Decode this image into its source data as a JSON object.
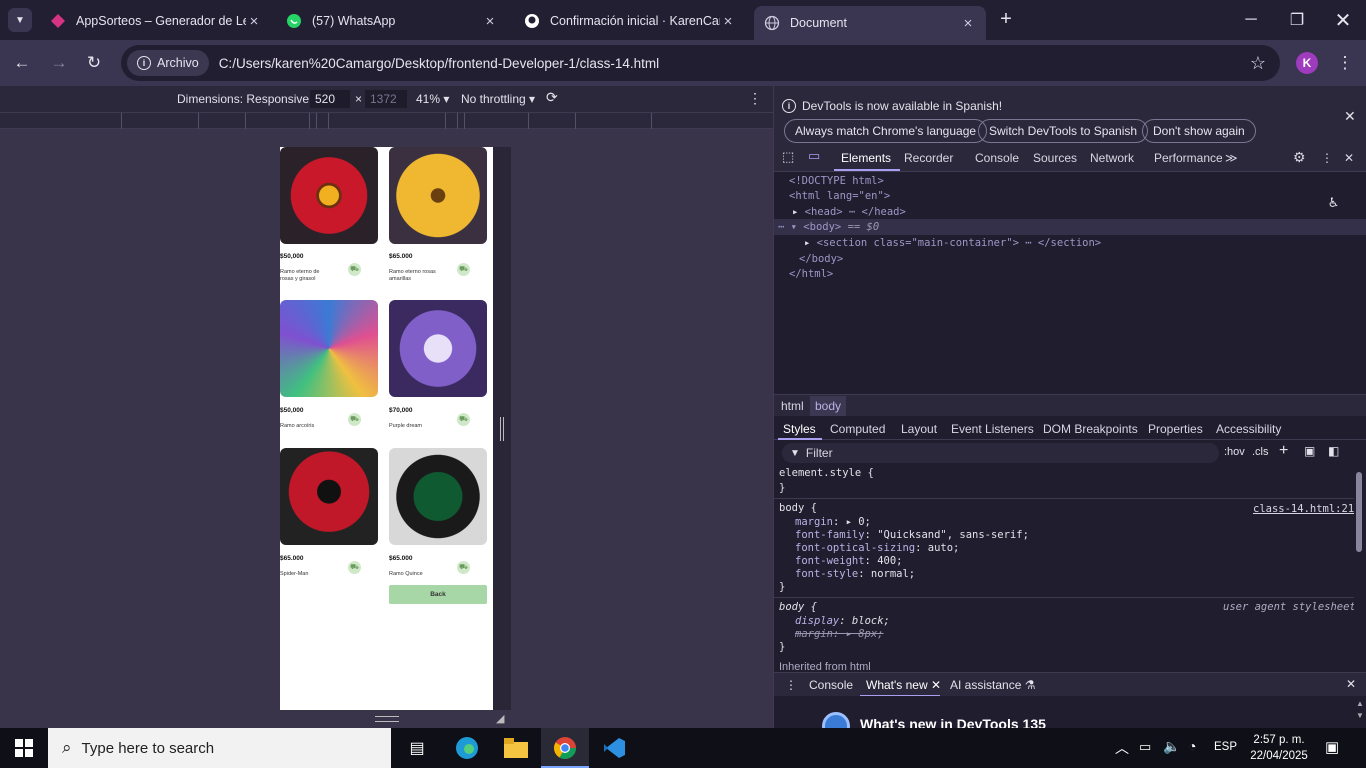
{
  "tabs": [
    {
      "title": "AppSorteos – Generador de Letras",
      "icon": "appsorteos-icon"
    },
    {
      "title": "(57) WhatsApp",
      "icon": "whatsapp-icon"
    },
    {
      "title": "Confirmación inicial · KarenCamargo",
      "icon": "github-icon"
    },
    {
      "title": "Document",
      "icon": "globe-icon"
    }
  ],
  "new_tab": "+",
  "omnibox": {
    "chip": "Archivo",
    "url": "C:/Users/karen%20Camargo/Desktop/frontend-Developer-1/class-14.html"
  },
  "profile_initial": "K",
  "device_toolbar": {
    "dimensions": "Dimensions: Responsive",
    "width": "520",
    "height": "1372",
    "zoom": "41%",
    "throttle": "No throttling"
  },
  "products": [
    {
      "price": "$50,000",
      "name": "Ramo eterno de rosas y girasol",
      "colors": [
        "#8a1220",
        "#e8b020"
      ]
    },
    {
      "price": "$65.000",
      "name": "Ramo eterno rosas amarillas",
      "colors": [
        "#d89a1a",
        "#f5c842"
      ]
    },
    {
      "price": "$50,000",
      "name": "Ramo arcoíris",
      "colors": [
        "#3a7bd5",
        "#e05090"
      ]
    },
    {
      "price": "$70,000",
      "name": "Purple dream",
      "colors": [
        "#4a2a8a",
        "#c8b8f0"
      ]
    },
    {
      "price": "$65.000",
      "name": "Spider-Man",
      "colors": [
        "#b01020",
        "#111111"
      ]
    },
    {
      "price": "$65.000",
      "name": "Ramo Quince",
      "colors": [
        "#0f4a2a",
        "#1a1a1a"
      ]
    }
  ],
  "back_button": "Back",
  "devtools": {
    "info_message": "DevTools is now available in Spanish!",
    "info_buttons": [
      "Always match Chrome's language",
      "Switch DevTools to Spanish",
      "Don't show again"
    ],
    "tabs": [
      "Elements",
      "Recorder",
      "Console",
      "Sources",
      "Network",
      "Performance"
    ],
    "dom": {
      "doctype": "<!DOCTYPE html>",
      "html_open": "<html lang=\"en\">",
      "head": "<head> ⋯ </head>",
      "body_open": "<body>",
      "body_marker": "== $0",
      "section": "<section class=\"main-container\"> ⋯ </section>",
      "body_close": "</body>",
      "html_close": "</html>"
    },
    "breadcrumbs": [
      "html",
      "body"
    ],
    "style_tabs": [
      "Styles",
      "Computed",
      "Layout",
      "Event Listeners",
      "DOM Breakpoints",
      "Properties",
      "Accessibility"
    ],
    "filter_placeholder": "Filter",
    "hov": ":hov",
    "cls": ".cls",
    "styles": {
      "element_style": "element.style {",
      "close": "}",
      "rule_selector": "body {",
      "rule_source": "class-14.html:21",
      "props": [
        {
          "name": "margin",
          "value": "▸ 0;"
        },
        {
          "name": "font-family",
          "value": "\"Quicksand\", sans-serif;"
        },
        {
          "name": "font-optical-sizing",
          "value": "auto;"
        },
        {
          "name": "font-weight",
          "value": "400;"
        },
        {
          "name": "font-style",
          "value": "normal;"
        }
      ],
      "ua_selector": "body {",
      "ua_source": "user agent stylesheet",
      "ua_props": [
        {
          "name": "display",
          "value": "block;"
        },
        {
          "name": "margin",
          "value": "▸ 8px;"
        }
      ],
      "inherited": "Inherited from html"
    },
    "drawer_tabs": [
      "Console",
      "What's new",
      "AI assistance"
    ],
    "whats_new_title": "What's new in DevTools 135"
  },
  "taskbar": {
    "search_placeholder": "Type here to search",
    "lang": "ESP",
    "time": "2:57 p. m.",
    "date": "22/04/2025"
  }
}
